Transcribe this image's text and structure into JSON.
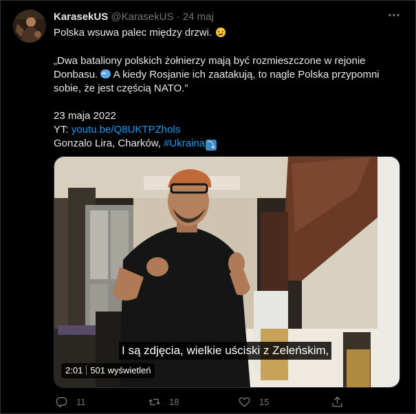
{
  "tweet": {
    "display_name": "KarasekUS",
    "handle": "@KarasekUS",
    "separator": "·",
    "date": "24 maj",
    "line1": "Polska wsuwa palec między drzwi.",
    "quote_line1": "„Dwa bataliony polskich żołnierzy mają być rozmieszczone w rejonie",
    "quote_line2a": "Donbasu.",
    "quote_line2b": "A kiedy Rosjanie ich zaatakują, to nagle Polska przypomni",
    "quote_line3": "sobie, że jest częścią NATO.”",
    "date_line": "23 maja 2022",
    "yt_label": "YT:",
    "yt_link": "youtu.be/Q8UKTPZhols",
    "credit_text": "Gonzalo Lira, Charków,",
    "hashtag": "#Ukraina"
  },
  "video": {
    "subtitle": "I są zdjęcia, wielkie uściski z Zeleńskim,",
    "duration": "2:01",
    "views": "501 wyświetleń"
  },
  "actions": {
    "replies": "11",
    "retweets": "18",
    "likes": "15"
  },
  "icons": [
    "more-icon",
    "reply-icon",
    "retweet-icon",
    "like-icon",
    "share-icon"
  ],
  "colors": {
    "background": "#000000",
    "text": "#e7e9ea",
    "muted": "#71767b",
    "link": "#1d9bf0"
  }
}
